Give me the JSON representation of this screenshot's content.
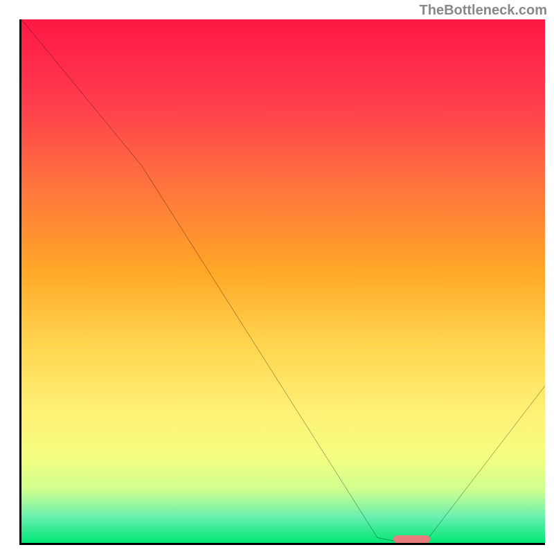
{
  "watermark": "TheBottleneck.com",
  "chart_data": {
    "type": "line",
    "title": "",
    "xlabel": "",
    "ylabel": "",
    "xlim": [
      0,
      100
    ],
    "ylim": [
      0,
      100
    ],
    "x": [
      0,
      23,
      68,
      73,
      77,
      100
    ],
    "values": [
      100,
      72,
      1,
      0,
      0,
      30
    ],
    "marker": {
      "x_start": 71,
      "x_end": 78,
      "y": 0
    },
    "gradient_colors": [
      "#ff1744",
      "#ff3d4d",
      "#ff6e40",
      "#ffa726",
      "#ffd54f",
      "#fff176",
      "#f4ff81",
      "#ccff90",
      "#69f0ae",
      "#00e676"
    ]
  }
}
